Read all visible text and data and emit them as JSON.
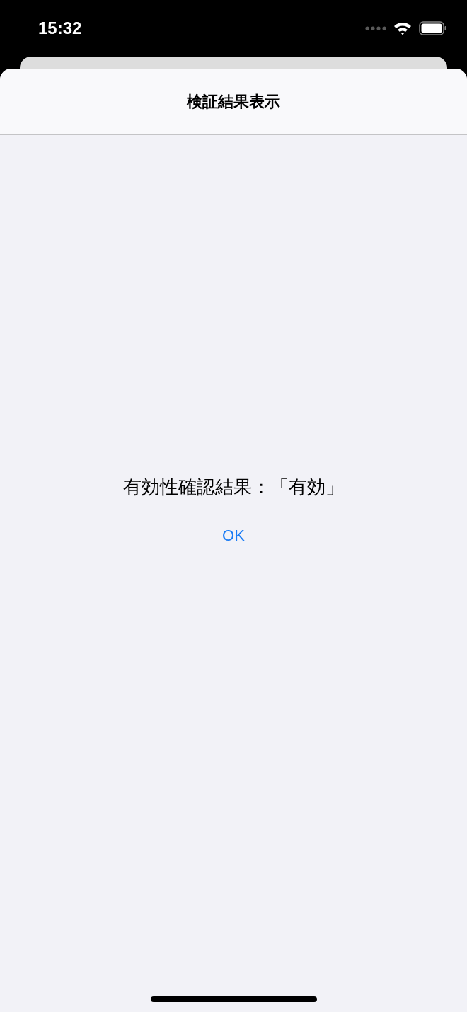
{
  "status_bar": {
    "time": "15:32"
  },
  "navigation_bar": {
    "title": "検証結果表示"
  },
  "message": "有効性確認結果：「有効」",
  "buttons": [
    "OK"
  ]
}
